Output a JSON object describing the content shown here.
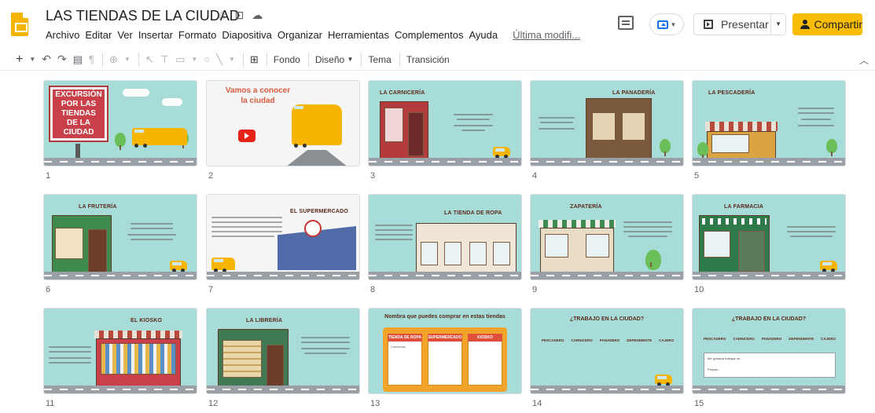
{
  "header": {
    "title": "LAS TIENDAS DE LA CIUDAD",
    "menu": [
      "Archivo",
      "Editar",
      "Ver",
      "Insertar",
      "Formato",
      "Diapositiva",
      "Organizar",
      "Herramientas",
      "Complementos",
      "Ayuda"
    ],
    "last_modified": "Última modifi...",
    "present_label": "Presentar",
    "share_label": "Compartir"
  },
  "toolbar": {
    "fondo": "Fondo",
    "diseno": "Diseño",
    "tema": "Tema",
    "transicion": "Transición"
  },
  "slides": [
    {
      "num": "1",
      "title": "EXCURSIÓN POR LAS TIENDAS DE LA CIUDAD"
    },
    {
      "num": "2",
      "title": "Vamos a conocer la ciudad"
    },
    {
      "num": "3",
      "title": "LA CARNICERÍA"
    },
    {
      "num": "4",
      "title": "LA PANADERÍA"
    },
    {
      "num": "5",
      "title": "LA PESCADERÍA"
    },
    {
      "num": "6",
      "title": "LA FRUTERÍA"
    },
    {
      "num": "7",
      "title": "EL SUPERMERCADO"
    },
    {
      "num": "8",
      "title": "LA TIENDA DE ROPA"
    },
    {
      "num": "9",
      "title": "ZAPATERÍA"
    },
    {
      "num": "10",
      "title": "LA FARMACIA"
    },
    {
      "num": "11",
      "title": "EL KIOSKO"
    },
    {
      "num": "12",
      "title": "LA LIBRERÍA"
    },
    {
      "num": "13",
      "title": "Nombra que puedes comprar en estas tiendas",
      "columns": [
        "TIENDA DE ROPA",
        "SUPERMERCADO",
        "KIOSKO"
      ],
      "cell_label": "Camisetas"
    },
    {
      "num": "14",
      "title": "¿TRABAJO EN LA CIUDAD?",
      "jobs": [
        "PESCADERO",
        "CARNICERO",
        "PANADERO",
        "DEPENDIENTE",
        "CAJERO"
      ]
    },
    {
      "num": "15",
      "title": "¿TRABAJO EN LA CIUDAD?",
      "answer_lines": [
        "Me gustaría trabajar de...",
        "Porque..."
      ]
    }
  ]
}
